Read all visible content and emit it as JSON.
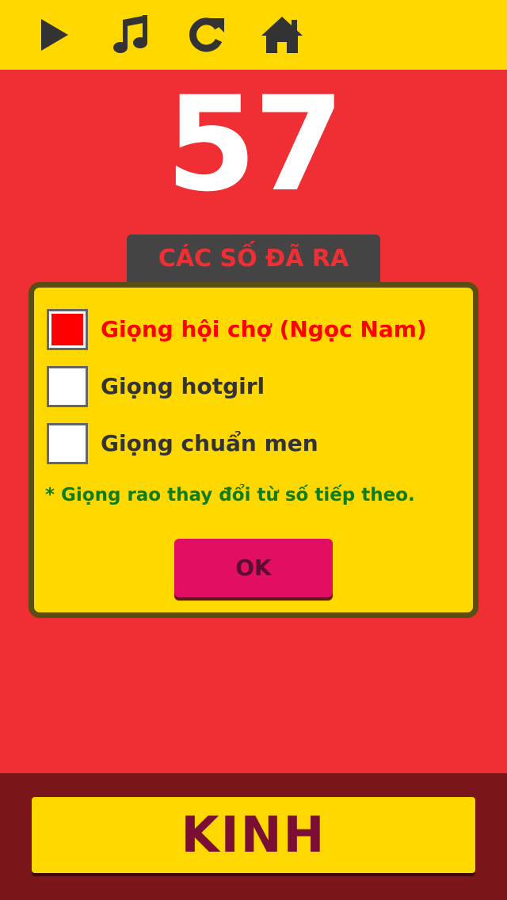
{
  "toolbar": {
    "play_icon": "play-icon",
    "music_icon": "music-note-icon",
    "replay_icon": "refresh-icon",
    "home_icon": "home-icon"
  },
  "current_number": "57",
  "drawn_numbers_tab": "CÁC SỐ ĐÃ RA",
  "voice_dialog": {
    "options": [
      {
        "label": "Giọng hội chợ (Ngọc Nam)",
        "checked": true
      },
      {
        "label": "Giọng hotgirl",
        "checked": false
      },
      {
        "label": "Giọng chuẩn men",
        "checked": false
      }
    ],
    "note": "* Giọng rao thay đổi từ số tiếp theo.",
    "ok_label": "OK"
  },
  "bottom": {
    "kinh_label": "KINH"
  },
  "colors": {
    "background": "#ef2f33",
    "toolbar": "#ffd800",
    "selected_option": "#ff0000",
    "note": "#0d7d1d",
    "ok_button": "#e20e62",
    "bottom_bar": "#7a161a"
  }
}
